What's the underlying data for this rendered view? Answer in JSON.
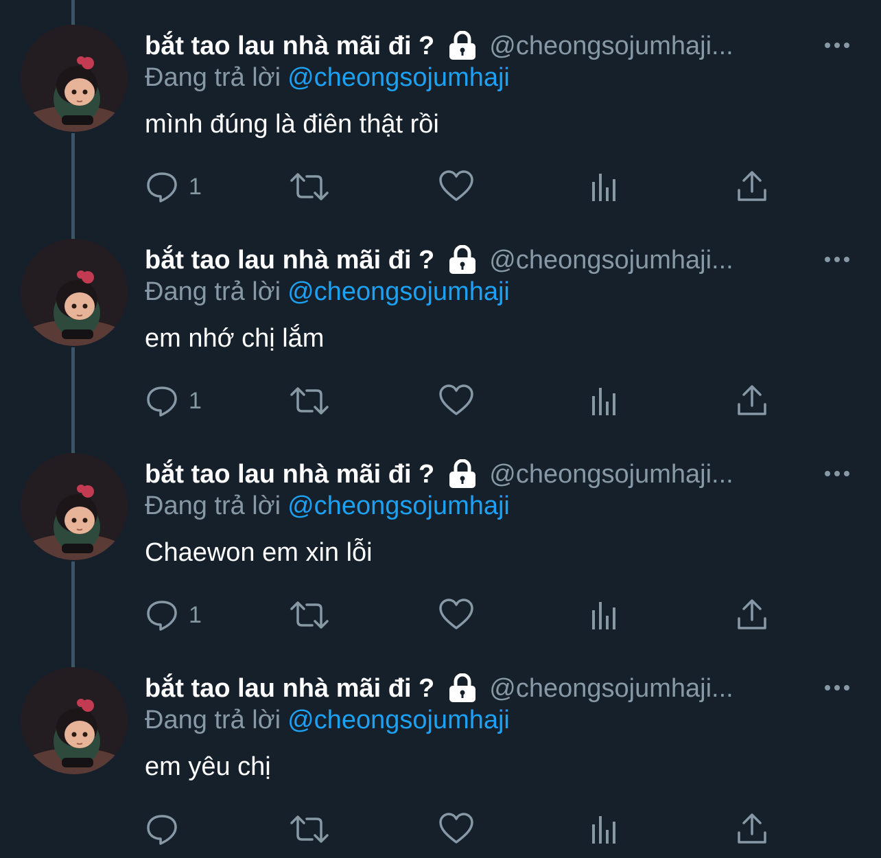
{
  "colors": {
    "background": "#15202b",
    "secondary_text": "#8899a6",
    "link": "#1da1f2",
    "thread_line": "#3d5466"
  },
  "tweets": [
    {
      "display_name": "bắt tao lau nhà mãi đi ?",
      "handle": "@cheongsojumhaji...",
      "reply_prefix": "Đang trả lời",
      "reply_handle": "@cheongsojumhaji",
      "text": "mình đúng là điên thật rồi",
      "reply_count": "1"
    },
    {
      "display_name": "bắt tao lau nhà mãi đi ?",
      "handle": "@cheongsojumhaji...",
      "reply_prefix": "Đang trả lời",
      "reply_handle": "@cheongsojumhaji",
      "text": "em nhớ chị lắm",
      "reply_count": "1"
    },
    {
      "display_name": "bắt tao lau nhà mãi đi ?",
      "handle": "@cheongsojumhaji...",
      "reply_prefix": "Đang trả lời",
      "reply_handle": "@cheongsojumhaji",
      "text": "Chaewon em xin lỗi",
      "reply_count": "1"
    },
    {
      "display_name": "bắt tao lau nhà mãi đi ?",
      "handle": "@cheongsojumhaji...",
      "reply_prefix": "Đang trả lời",
      "reply_handle": "@cheongsojumhaji",
      "text": "em yêu chị",
      "reply_count": ""
    }
  ],
  "icons": {
    "locked": "lock-icon",
    "more": "more-icon",
    "reply": "reply-icon",
    "retweet": "retweet-icon",
    "like": "heart-icon",
    "analytics": "analytics-icon",
    "share": "share-icon"
  }
}
